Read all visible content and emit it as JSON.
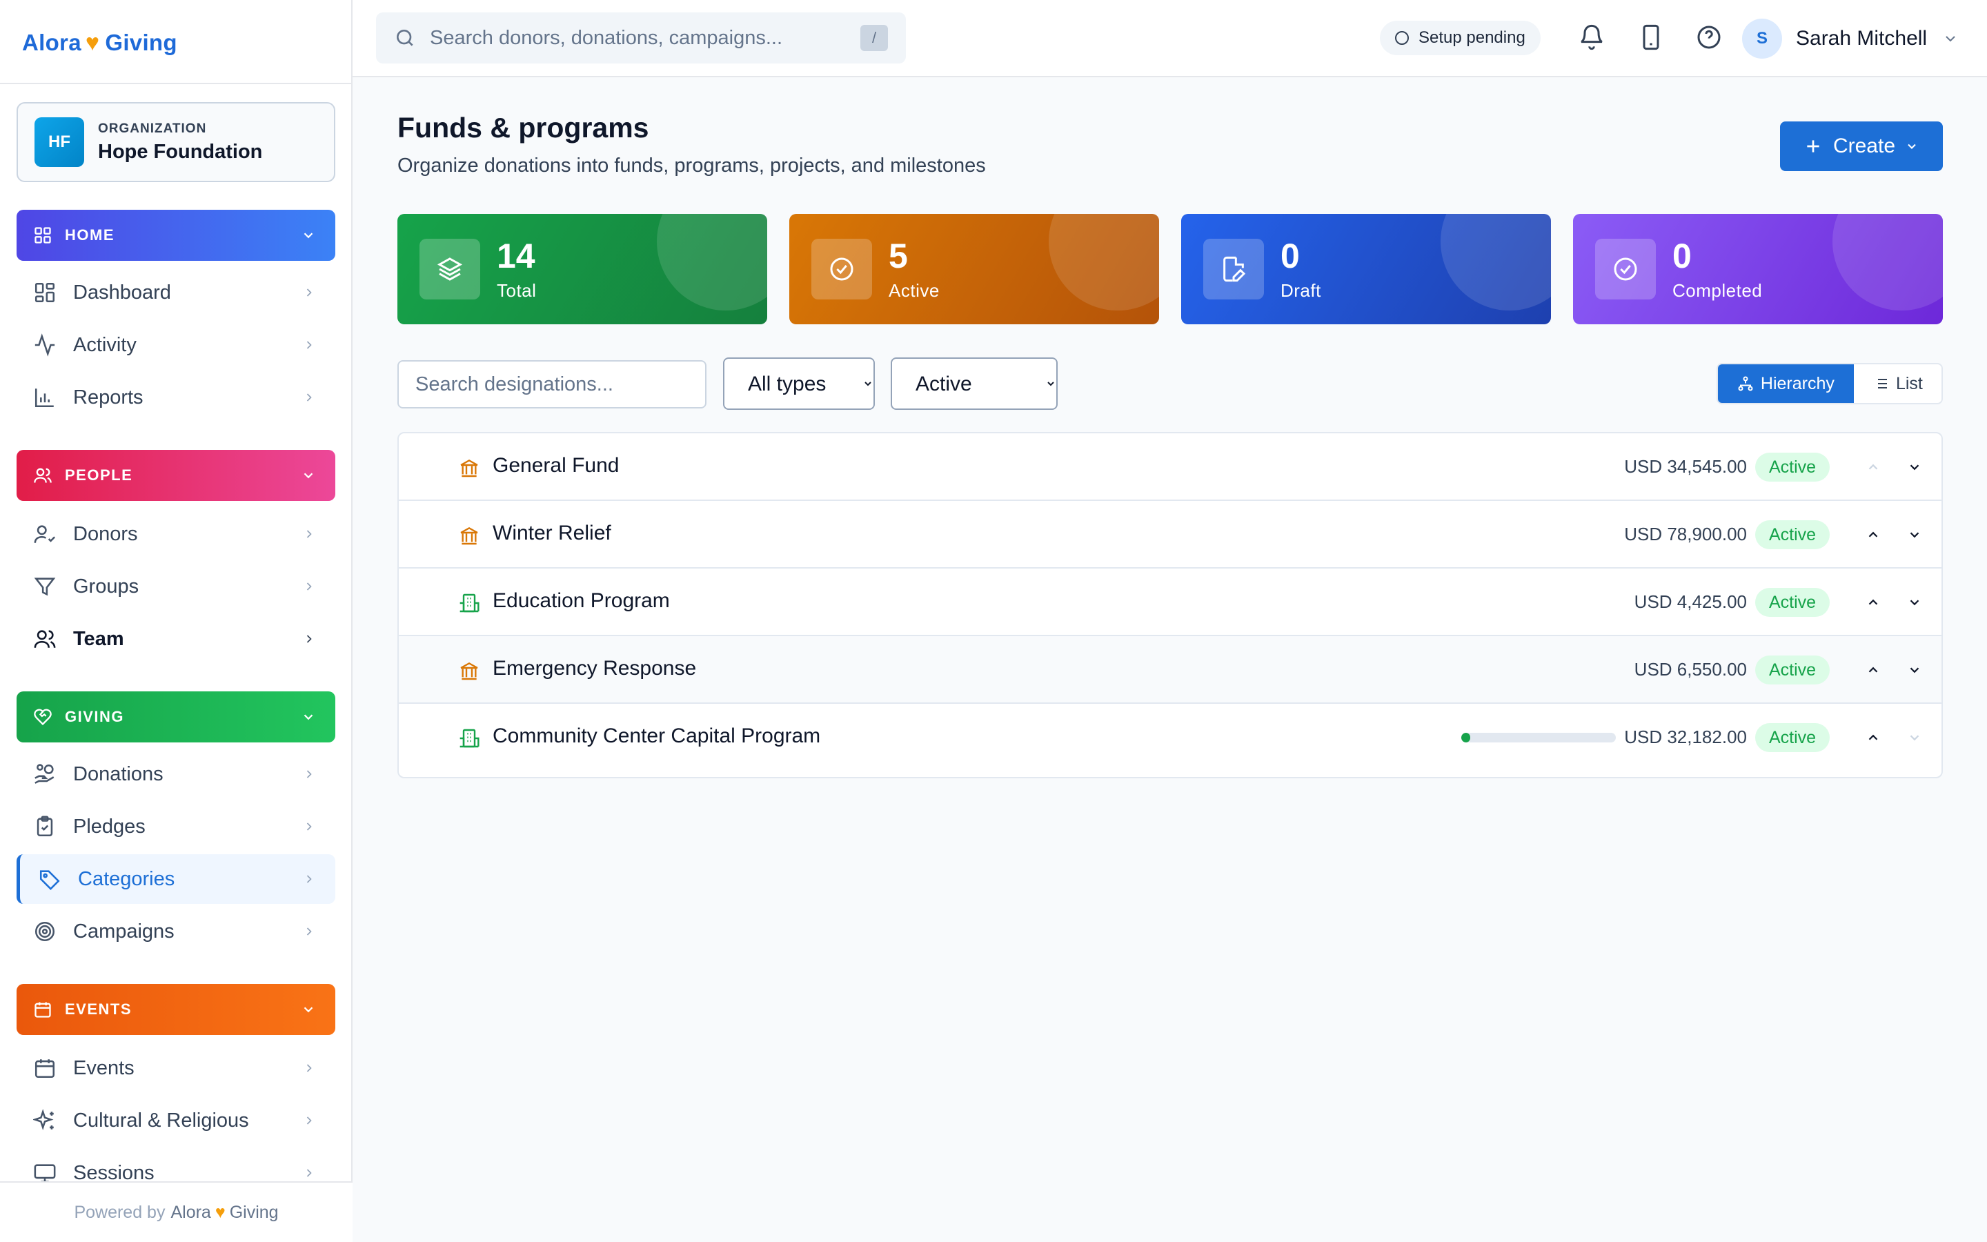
{
  "brand": {
    "name_left": "Alora",
    "heart": "♥",
    "name_right": "Giving"
  },
  "org": {
    "initials": "HF",
    "label": "ORGANIZATION",
    "name": "Hope Foundation"
  },
  "sidebar": {
    "sections": [
      {
        "label": "HOME",
        "icon": "grid-icon",
        "color": "#4f46e5",
        "items": [
          {
            "label": "Dashboard",
            "icon": "grid-icon"
          },
          {
            "label": "Activity",
            "icon": "activity-icon"
          },
          {
            "label": "Reports",
            "icon": "bar-chart-icon"
          }
        ]
      },
      {
        "label": "PEOPLE",
        "icon": "users-icon",
        "color": "#e11d48",
        "items": [
          {
            "label": "Donors",
            "icon": "user-check-icon"
          },
          {
            "label": "Groups",
            "icon": "filter-icon"
          },
          {
            "label": "Team",
            "icon": "users-icon"
          }
        ]
      },
      {
        "label": "GIVING",
        "icon": "heart-hand-icon",
        "color": "#16a34a",
        "items": [
          {
            "label": "Donations",
            "icon": "hand-coins-icon"
          },
          {
            "label": "Pledges",
            "icon": "clipboard-icon"
          },
          {
            "label": "Categories",
            "icon": "tag-icon"
          },
          {
            "label": "Campaigns",
            "icon": "target-icon"
          }
        ]
      },
      {
        "label": "EVENTS",
        "icon": "calendar-icon",
        "color": "#ea580c",
        "items": [
          {
            "label": "Events",
            "icon": "calendar-icon"
          },
          {
            "label": "Cultural & Religious",
            "icon": "sparkles-icon"
          },
          {
            "label": "Sessions",
            "icon": "monitor-icon"
          }
        ]
      }
    ],
    "active_item": "Categories",
    "footer": {
      "prefix": "Powered by",
      "brand_left": "Alora",
      "heart": "♥",
      "brand_right": "Giving"
    }
  },
  "topbar": {
    "search_placeholder": "Search donors, donations, campaigns...",
    "search_shortcut": "/",
    "setup_status": "Setup pending",
    "user": {
      "initial": "S",
      "name": "Sarah Mitchell"
    }
  },
  "page": {
    "title": "Funds & programs",
    "subtitle": "Organize donations into funds, programs, projects, and milestones",
    "create_label": "Create"
  },
  "stats": [
    {
      "value": "14",
      "label": "Total",
      "icon": "layers-icon"
    },
    {
      "value": "5",
      "label": "Active",
      "icon": "check-circle-icon"
    },
    {
      "value": "0",
      "label": "Draft",
      "icon": "file-edit-icon"
    },
    {
      "value": "0",
      "label": "Completed",
      "icon": "check-circle-icon"
    }
  ],
  "filters": {
    "search_placeholder": "Search designations...",
    "type_options": [
      "All types"
    ],
    "type_selected": "All types",
    "status_options": [
      "Active"
    ],
    "status_selected": "Active",
    "view_hierarchy": "Hierarchy",
    "view_list": "List"
  },
  "designations": [
    {
      "name": "General Fund",
      "icon": "bank-icon",
      "icon_color": "#d97706",
      "amount": "USD 34,545.00",
      "status": "Active"
    },
    {
      "name": "Winter Relief",
      "icon": "bank-icon",
      "icon_color": "#d97706",
      "amount": "USD 78,900.00",
      "status": "Active"
    },
    {
      "name": "Education Program",
      "icon": "building-icon",
      "icon_color": "#16a34a",
      "amount": "USD 4,425.00",
      "status": "Active"
    },
    {
      "name": "Emergency Response",
      "icon": "bank-icon",
      "icon_color": "#d97706",
      "amount": "USD 6,550.00",
      "status": "Active"
    },
    {
      "name": "Community Center Capital Program",
      "icon": "building-icon",
      "icon_color": "#16a34a",
      "amount": "USD 32,182.00",
      "status": "Active",
      "progress": 0.03
    }
  ]
}
